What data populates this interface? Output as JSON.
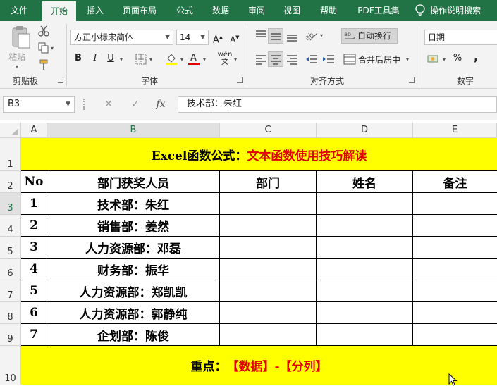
{
  "tabs": [
    "文件",
    "开始",
    "插入",
    "页面布局",
    "公式",
    "数据",
    "审阅",
    "视图",
    "帮助",
    "PDF工具集"
  ],
  "tab_search": "操作说明搜索",
  "clipboard": {
    "paste_label": "粘贴",
    "group_label": "剪贴板"
  },
  "font": {
    "family": "方正小标宋简体",
    "size": "14",
    "group_label": "字体",
    "bold": "B",
    "italic": "I",
    "underline": "U",
    "grow": "A",
    "shrink": "A"
  },
  "alignment": {
    "wrap_label": "自动换行",
    "merge_label": "合并后居中",
    "group_label": "对齐方式"
  },
  "number": {
    "format": "日期",
    "group_label": "数字",
    "percent": "%",
    "comma": ","
  },
  "formula_bar": {
    "name_box": "B3",
    "fx": "fx",
    "content": "技术部：朱红"
  },
  "columns": [
    "A",
    "B",
    "C",
    "D",
    "E"
  ],
  "rows": [
    "1",
    "2",
    "3",
    "4",
    "5",
    "6",
    "7",
    "8",
    "9",
    "10"
  ],
  "sheet": {
    "title_black": "Excel函数公式：",
    "title_red": "文本函数使用技巧解读",
    "headers": [
      "No",
      "部门获奖人员",
      "部门",
      "姓名",
      "备注"
    ],
    "records": [
      {
        "no": "1",
        "person": "技术部：朱红"
      },
      {
        "no": "2",
        "person": "销售部：姜然"
      },
      {
        "no": "3",
        "person": "人力资源部：邓磊"
      },
      {
        "no": "4",
        "person": "财务部：振华"
      },
      {
        "no": "5",
        "person": "人力资源部：郑凯凯"
      },
      {
        "no": "6",
        "person": "人力资源部：郭静纯"
      },
      {
        "no": "7",
        "person": "企划部：陈俊"
      }
    ],
    "footer_black": "重点：",
    "footer_red": "【数据】-【分列】"
  },
  "colors": {
    "excel_green": "#217346",
    "highlight_yellow": "#ffff00",
    "accent_red": "#e00000"
  }
}
